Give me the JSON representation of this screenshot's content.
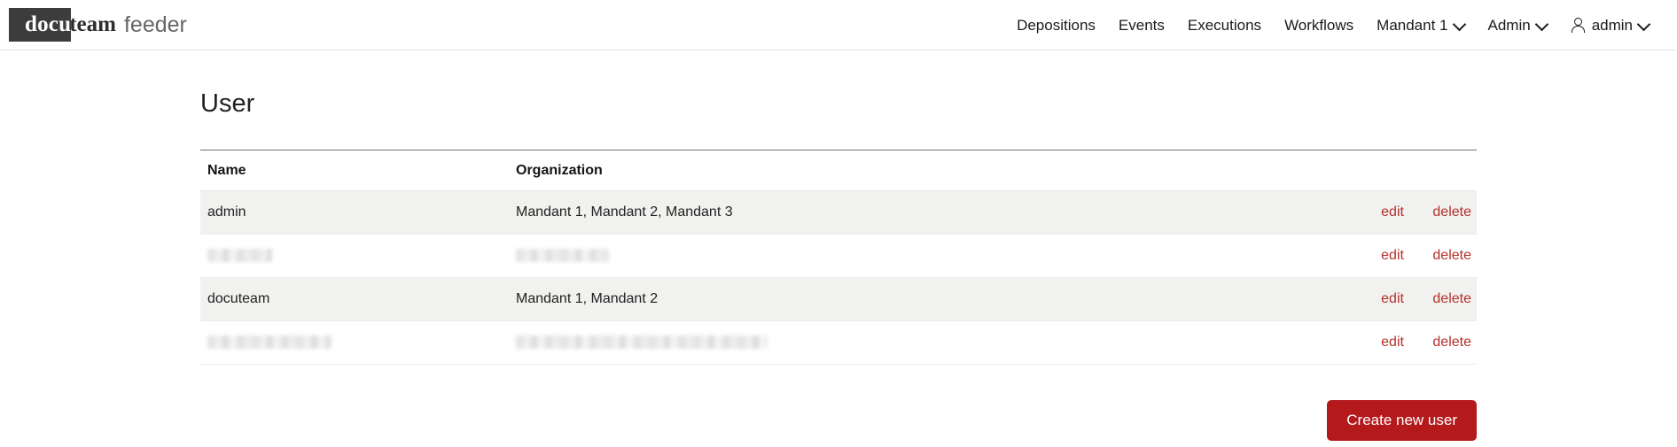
{
  "brand": {
    "mark_first": "docu",
    "mark_second": "team",
    "product": "feeder"
  },
  "nav": {
    "items": [
      {
        "label": "Depositions",
        "has_caret": false,
        "icon": null
      },
      {
        "label": "Events",
        "has_caret": false,
        "icon": null
      },
      {
        "label": "Executions",
        "has_caret": false,
        "icon": null
      },
      {
        "label": "Workflows",
        "has_caret": false,
        "icon": null
      },
      {
        "label": "Mandant 1",
        "has_caret": true,
        "icon": "chevron-down-icon"
      },
      {
        "label": "Admin",
        "has_caret": true,
        "icon": "chevron-down-icon"
      },
      {
        "label": "admin",
        "has_caret": true,
        "icon": "user-icon"
      }
    ]
  },
  "page": {
    "title": "User"
  },
  "table": {
    "columns": [
      {
        "key": "name",
        "label": "Name"
      },
      {
        "key": "organization",
        "label": "Organization"
      },
      {
        "key": "actions",
        "label": ""
      }
    ],
    "rows": [
      {
        "name": "admin",
        "organization": "Mandant 1, Mandant 2, Mandant 3",
        "name_redacted": false,
        "organization_redacted": false,
        "edit_label": "edit",
        "delete_label": "delete"
      },
      {
        "name": "",
        "organization": "",
        "name_redacted": true,
        "organization_redacted": true,
        "edit_label": "edit",
        "delete_label": "delete"
      },
      {
        "name": "docuteam",
        "organization": "Mandant 1, Mandant 2",
        "name_redacted": false,
        "organization_redacted": false,
        "edit_label": "edit",
        "delete_label": "delete"
      },
      {
        "name": "",
        "organization": "",
        "name_redacted": true,
        "organization_redacted": true,
        "edit_label": "edit",
        "delete_label": "delete"
      }
    ]
  },
  "footer": {
    "create_button_label": "Create new user"
  },
  "colors": {
    "brand_mark_bg": "#3c3c3c",
    "action_link": "#b5302b",
    "primary_button": "#b4191c",
    "row_stripe": "#f1f1ef"
  }
}
